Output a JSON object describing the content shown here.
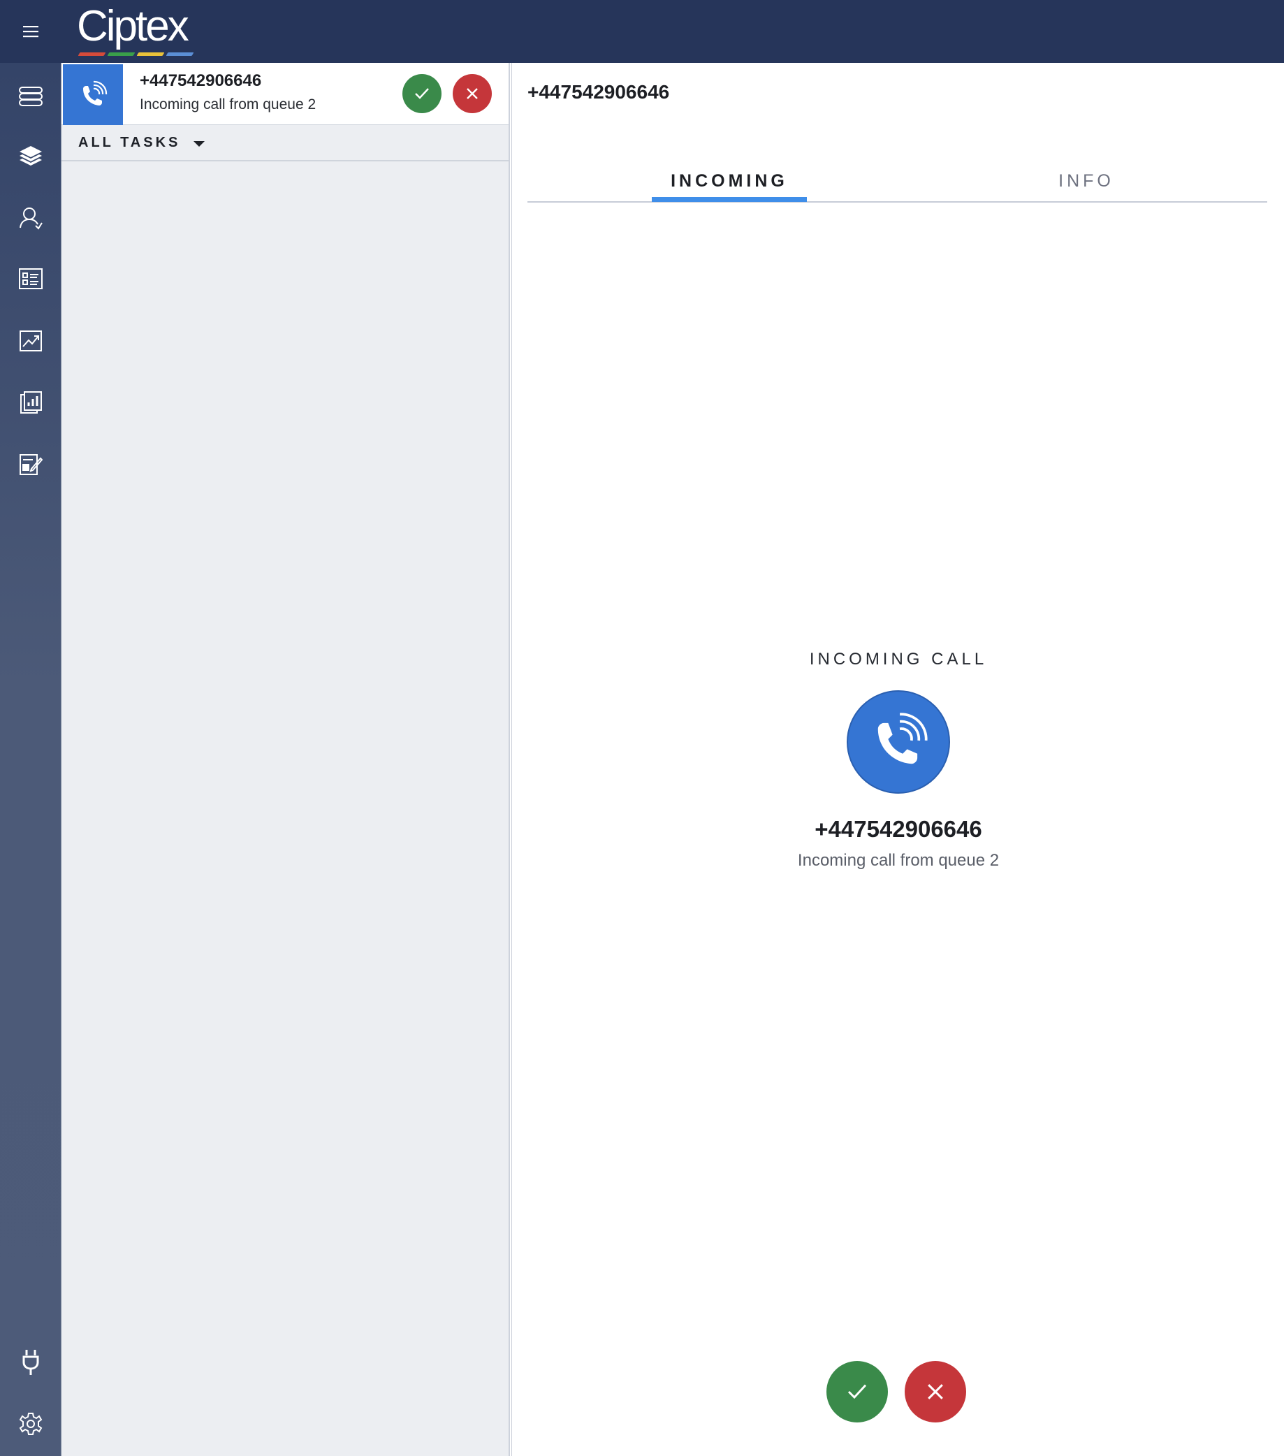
{
  "brand": {
    "logo_text": "Ciptex",
    "logo_colors": [
      "#d64b3a",
      "#3aa04a",
      "#e9c23a",
      "#5b8fd6"
    ]
  },
  "colors": {
    "topbar": "#26355a",
    "accent_blue": "#3575d3",
    "tab_underline": "#3f8ee9",
    "accept_green": "#3a8a4a",
    "reject_red": "#c5363a"
  },
  "nav": {
    "items": [
      {
        "icon": "server-stack-icon"
      },
      {
        "icon": "layers-icon"
      },
      {
        "icon": "contact-person-icon"
      },
      {
        "icon": "directory-list-icon"
      },
      {
        "icon": "trend-chart-icon"
      },
      {
        "icon": "bar-report-icon"
      },
      {
        "icon": "edit-form-icon"
      }
    ],
    "bottom_items": [
      {
        "icon": "plug-icon"
      },
      {
        "icon": "settings-gear-icon"
      }
    ]
  },
  "task": {
    "number": "+447542906646",
    "subtitle": "Incoming call from queue 2"
  },
  "task_filter": {
    "label": "ALL TASKS"
  },
  "detail": {
    "title": "+447542906646",
    "tabs": [
      {
        "label": "INCOMING",
        "active": true
      },
      {
        "label": "INFO",
        "active": false
      }
    ],
    "incoming_label": "INCOMING CALL",
    "caller_number": "+447542906646",
    "caller_subtitle": "Incoming call from queue 2"
  }
}
